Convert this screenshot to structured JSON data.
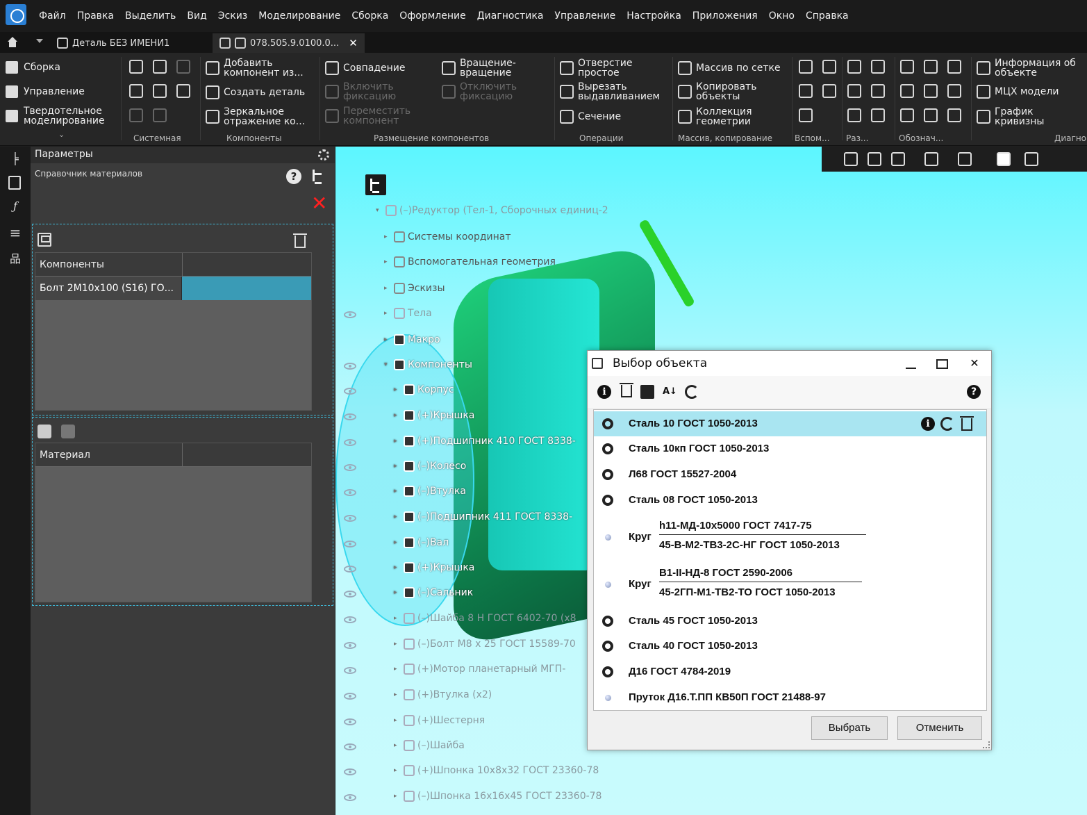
{
  "menu": [
    "Файл",
    "Правка",
    "Выделить",
    "Вид",
    "Эскиз",
    "Моделирование",
    "Сборка",
    "Оформление",
    "Диагностика",
    "Управление",
    "Настройка",
    "Приложения",
    "Окно",
    "Справка"
  ],
  "tabs": [
    {
      "label": "Деталь БЕЗ ИМЕНИ1"
    },
    {
      "label": "078.505.9.0100.0..."
    }
  ],
  "ribbon": {
    "modes": [
      "Сборка",
      "Управление",
      "Твердотельное моделирование"
    ],
    "buttons": {
      "add_component": "Добавить компонент из...",
      "create_part": "Создать деталь",
      "mirror_component": "Зеркальное отражение ко...",
      "coincidence": "Совпадение",
      "enable_fix": "Включить фиксацию",
      "move_component": "Переместить компонент",
      "rotate_rotate": "Вращение-вращение",
      "disable_fix": "Отключить фиксацию",
      "hole_simple": "Отверстие простое",
      "cut_extrude": "Вырезать выдавливанием",
      "section": "Сечение",
      "grid_array": "Массив по сетке",
      "copy_objects": "Копировать объекты",
      "geometry_collection": "Коллекция геометрии",
      "object_info": "Информация об объекте",
      "mcx_models": "МЦХ модели",
      "curvature_graph": "График кривизны"
    },
    "groups": [
      "Системная",
      "Компоненты",
      "Размещение компонентов",
      "Операции",
      "Массив, копирование",
      "Вспом...",
      "Раз...",
      "Обознач...",
      "Диагно"
    ]
  },
  "params": {
    "title": "Параметры",
    "subtitle": "Справочник материалов",
    "components_header": "Компоненты",
    "component_row": "Болт 2М10х100 (S16) ГО...",
    "material_header": "Материал"
  },
  "tree": {
    "root": "Редуктор (Тел-1, Сборочных единиц-2",
    "nodes": [
      "Системы координат",
      "Вспомогательная геометрия",
      "Эскизы",
      "Тела",
      "Макро",
      "Компоненты",
      "Корпус",
      "Крышка",
      "Подшипник 410 ГОСТ 8338-",
      "Колесо",
      "Втулка",
      "Подшипник 411 ГОСТ 8338-",
      "Вал",
      "Крышка",
      "Сальник",
      "Шайба 8 Н ГОСТ 6402-70 (х8",
      "Болт М8 х 25 ГОСТ 15589-70",
      "Мотор планетарный МГП-",
      "Втулка (х2)",
      "Шестерня",
      "Шайба",
      "Шпонка 10х8х32 ГОСТ 23360-78",
      "Шпонка 16х16х45 ГОСТ 23360-78"
    ]
  },
  "dialog": {
    "title": "Выбор объекта",
    "items": [
      {
        "label": "Сталь 10 ГОСТ 1050-2013",
        "selected": true
      },
      {
        "label": "Сталь 10кп ГОСТ 1050-2013"
      },
      {
        "label": "Л68 ГОСТ 15527-2004"
      },
      {
        "label": "Сталь 08 ГОСТ 1050-2013"
      },
      {
        "label": "Круг",
        "top": "h11-МД-10х5000 ГОСТ 7417-75",
        "bottom": "45-В-М2-ТВ3-2С-НГ ГОСТ 1050-2013"
      },
      {
        "label": "Круг",
        "top": "В1-II-НД-8 ГОСТ 2590-2006",
        "bottom": "45-2ГП-М1-ТВ2-ТО ГОСТ 1050-2013"
      },
      {
        "label": "Сталь 45 ГОСТ 1050-2013"
      },
      {
        "label": "Сталь 40 ГОСТ 1050-2013"
      },
      {
        "label": "Д16 ГОСТ 4784-2019"
      },
      {
        "label": "Пруток Д16.Т.ПП КВ50П ГОСТ 21488-97"
      }
    ],
    "select_button": "Выбрать",
    "cancel_button": "Отменить"
  },
  "colors": {
    "viewport": "#5cf6ff",
    "selection": "#a9e5f1",
    "accent": "#3a9bb6"
  }
}
